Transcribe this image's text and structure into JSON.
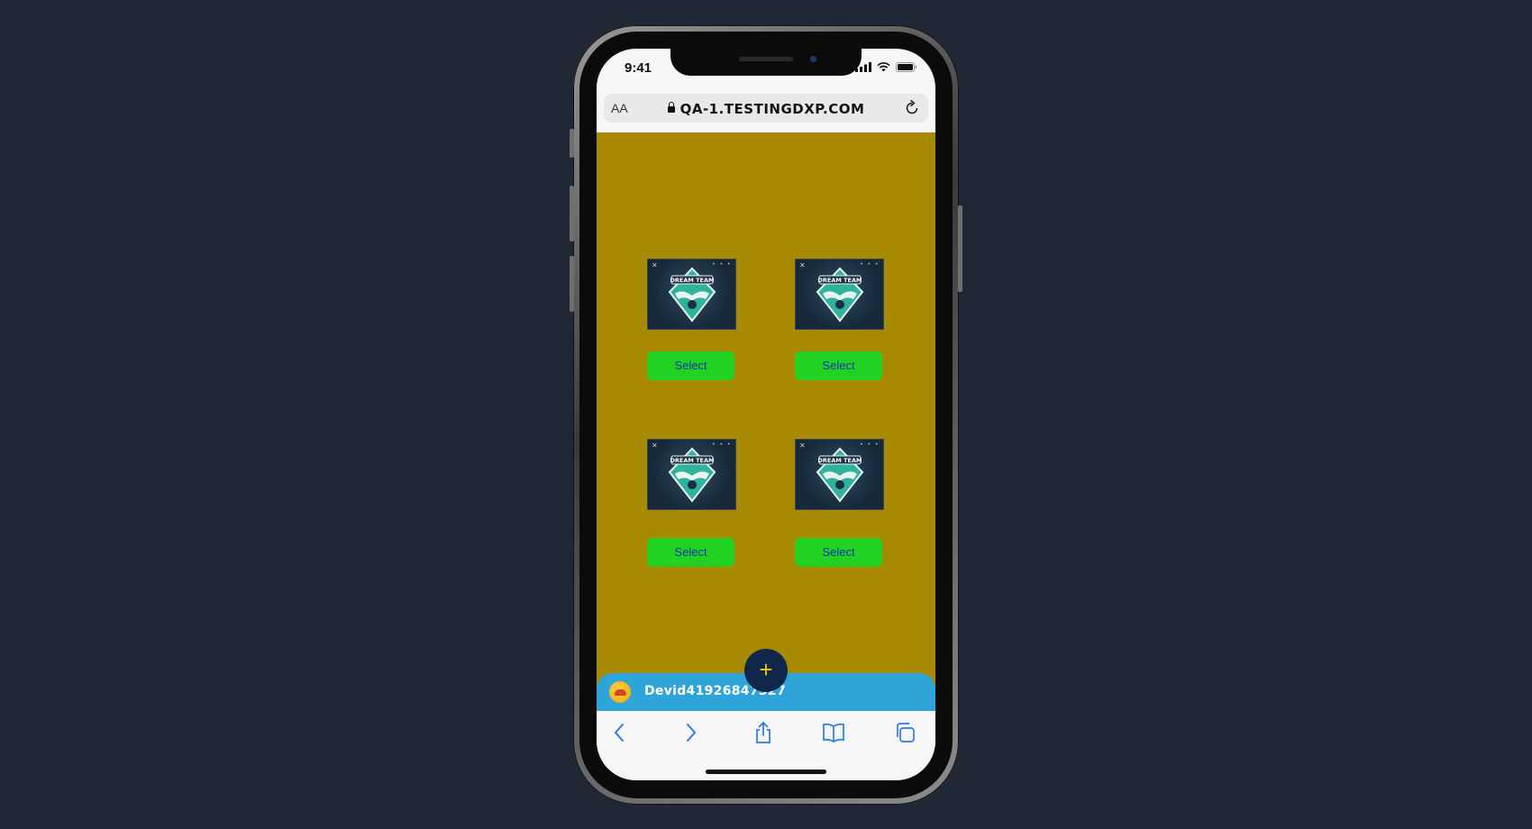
{
  "status": {
    "time": "9:41"
  },
  "browser": {
    "text_size_label": "AA",
    "url": "QA-1.TESTINGDXP.COM"
  },
  "cards": [
    {
      "image_alt": "DREAM TEAM",
      "select_label": "Select"
    },
    {
      "image_alt": "DREAM TEAM",
      "select_label": "Select"
    },
    {
      "image_alt": "DREAM TEAM",
      "select_label": "Select"
    },
    {
      "image_alt": "DREAM TEAM",
      "select_label": "Select"
    }
  ],
  "user": {
    "username": "Devid41926847327"
  },
  "fab": {
    "label": "+"
  },
  "toolbar": {
    "icons": [
      "back-icon",
      "forward-icon",
      "share-icon",
      "bookmarks-icon",
      "tabs-icon"
    ]
  },
  "colors": {
    "page_background": "#212835",
    "content_background": "#a78902",
    "select_button": "#22d222",
    "select_text": "#1a33b3",
    "user_bar": "#2ea4d8",
    "fab_background": "#0f2748",
    "fab_plus": "#f1c40f"
  }
}
